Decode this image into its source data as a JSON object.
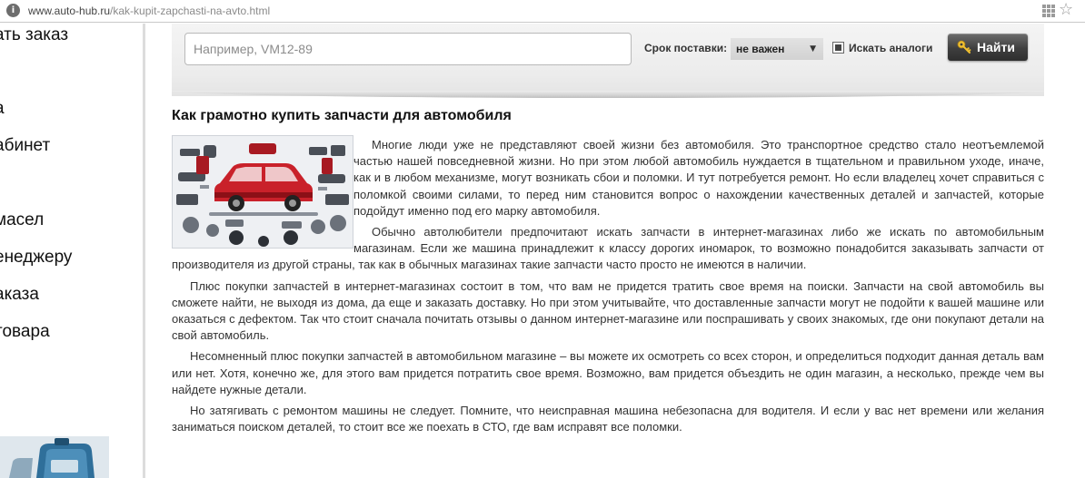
{
  "browser": {
    "url_host": "www.auto-hub.ru",
    "url_path": "/kak-kupit-zapchasti-na-avto.html"
  },
  "sidebar": {
    "items": [
      {
        "label": "ать заказ"
      },
      {
        "label": "а"
      },
      {
        "label": "абинет"
      },
      {
        "label": "масел"
      },
      {
        "label": "енеджеру"
      },
      {
        "label": "аказа"
      },
      {
        "label": "товара"
      },
      {
        "label": "ı"
      }
    ]
  },
  "search": {
    "placeholder": "Например, VM12-89",
    "delivery_label": "Срок поставки:",
    "delivery_value": "не важен",
    "analogs_label": "Искать аналоги",
    "analogs_checked": true,
    "find_label": "Найти"
  },
  "article": {
    "title": "Как грамотно купить запчасти для автомобиля",
    "paragraphs": [
      "Многие люди уже не представляют своей жизни без автомобиля. Это транспортное средство стало неотъемлемой частью нашей повседневной жизни. Но при этом любой автомобиль нуждается в тщательном и правильном уходе, иначе, как и в любом механизме, могут возникать сбои и поломки. И тут потребуется ремонт. Но если владелец хочет справиться с поломкой своими силами, то перед ним становится вопрос о нахождении качественных деталей и запчастей, которые подойдут именно под его марку автомобиля.",
      "Обычно автолюбители предпочитают искать запчасти в интернет-магазинах либо же искать по автомобильным магазинам. Если же машина принадлежит к классу дорогих иномарок, то возможно понадобится заказывать запчасти от производителя из другой страны, так как в обычных магазинах такие запчасти часто просто не имеются в наличии.",
      "Плюс покупки запчастей в интернет-магазинах состоит в том, что вам не придется тратить свое время на поиски. Запчасти на свой автомобиль вы сможете найти, не выходя из дома, да еще и заказать доставку. Но при этом учитывайте, что доставленные запчасти могут не подойти к вашей машине или оказаться с дефектом. Так что стоит сначала почитать отзывы о данном интернет-магазине или поспрашивать у своих знакомых, где они покупают детали на свой автомобиль.",
      "Несомненный плюс покупки запчастей в автомобильном магазине – вы можете их осмотреть со всех сторон, и определиться подходит данная деталь вам или нет. Хотя, конечно же, для этого вам придется потратить свое время. Возможно, вам придется объездить не один магазин, а несколько, прежде чем вы найдете нужные детали.",
      "Но затягивать с ремонтом машины не следует. Помните, что неисправная машина небезопасна для водителя. И если у вас нет времени или желания заниматься поиском деталей, то стоит все же поехать в СТО, где вам исправят все поломки."
    ]
  },
  "colors": {
    "button_dark": "#3e3e3e",
    "key_icon": "#f0c030",
    "panel_bg": "#ececec"
  }
}
